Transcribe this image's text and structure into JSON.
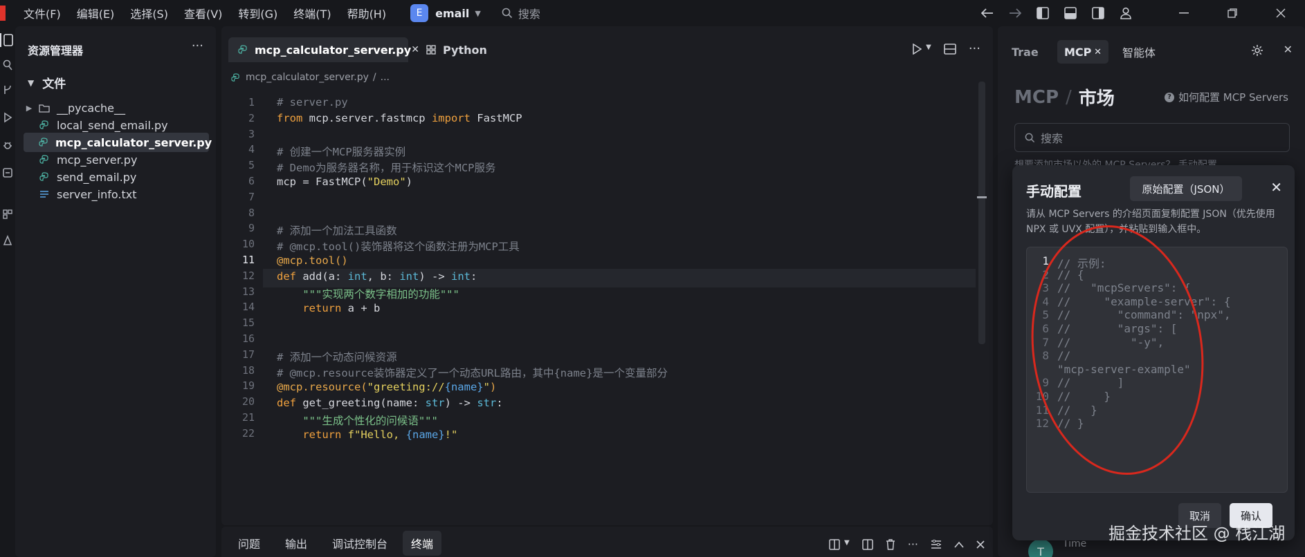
{
  "menubar": {
    "items": [
      "文件(F)",
      "编辑(E)",
      "选择(S)",
      "查看(V)",
      "转到(G)",
      "终端(T)",
      "帮助(H)"
    ],
    "workspace_badge": "E",
    "workspace_name": "email",
    "search_label": "搜索"
  },
  "explorer": {
    "title": "资源管理器",
    "more": "···",
    "section": "文件",
    "files": [
      {
        "name": "__pycache__",
        "kind": "folder-icon"
      },
      {
        "name": "local_send_email.py",
        "kind": "python-file-icon"
      },
      {
        "name": "mcp_calculator_server.py",
        "kind": "python-file-icon",
        "selected": true
      },
      {
        "name": "mcp_server.py",
        "kind": "python-file-icon"
      },
      {
        "name": "send_email.py",
        "kind": "python-file-icon"
      },
      {
        "name": "server_info.txt",
        "kind": "text-file-icon"
      }
    ]
  },
  "editor": {
    "active_tab": "mcp_calculator_server.py",
    "tab_close": "✕",
    "second_tab": "Python",
    "breadcrumb_file": "mcp_calculator_server.py",
    "breadcrumb_sep": "/",
    "breadcrumb_more": "...",
    "active_line": 11,
    "line_numbers": [
      "1",
      "2",
      "3",
      "4",
      "5",
      "6",
      "7",
      "8",
      "9",
      "10",
      "11",
      "12",
      "13",
      "14",
      "15",
      "16",
      "17",
      "18",
      "19",
      "20",
      "21",
      "22"
    ]
  },
  "bottom_panel": {
    "tabs": [
      "问题",
      "输出",
      "调试控制台",
      "终端"
    ],
    "active_tab": "终端"
  },
  "right_panel": {
    "tabs": [
      "Trae",
      "MCP",
      "智能体"
    ],
    "tab_close": "✕",
    "close": "✕",
    "heading_mcp": "MCP",
    "heading_sep": "/",
    "heading_market": "市场",
    "help_icon_text": "?",
    "help_link": "如何配置 MCP Servers",
    "search_placeholder": "搜索",
    "market_hint": "想要添加市场以外的 MCP Servers？ 手动配置",
    "list_avatar": "T",
    "list_name": "Time"
  },
  "dialog": {
    "title": "手动配置",
    "tab_label": "原始配置（JSON）",
    "close": "✕",
    "description": "请从 MCP Servers 的介绍页面复制配置 JSON（优先使用 NPX 或 UVX 配置），并粘贴到输入框中。",
    "line_numbers": [
      "1",
      "2",
      "3",
      "4",
      "5",
      "6",
      "7",
      "8",
      "",
      "9",
      "10",
      "11",
      "12"
    ],
    "lines": [
      "// 示例:",
      "// {",
      "//   \"mcpServers\": {",
      "//     \"example-server\": {",
      "//       \"command\": \"npx\",",
      "//       \"args\": [",
      "//         \"-y\",",
      "//",
      "\"mcp-server-example\"",
      "//       ]",
      "//     }",
      "//   }",
      "// }"
    ],
    "cancel": "取消",
    "confirm": "确认"
  },
  "watermark": "掘金技术社区 @ 栈江湖",
  "colors": {
    "accent_badge": "#5b87ef",
    "annotation": "#d9281d",
    "keyword": "#f0a13e",
    "string": "#e4d05e",
    "comment": "#7d828c",
    "type": "#5bb8d6"
  }
}
